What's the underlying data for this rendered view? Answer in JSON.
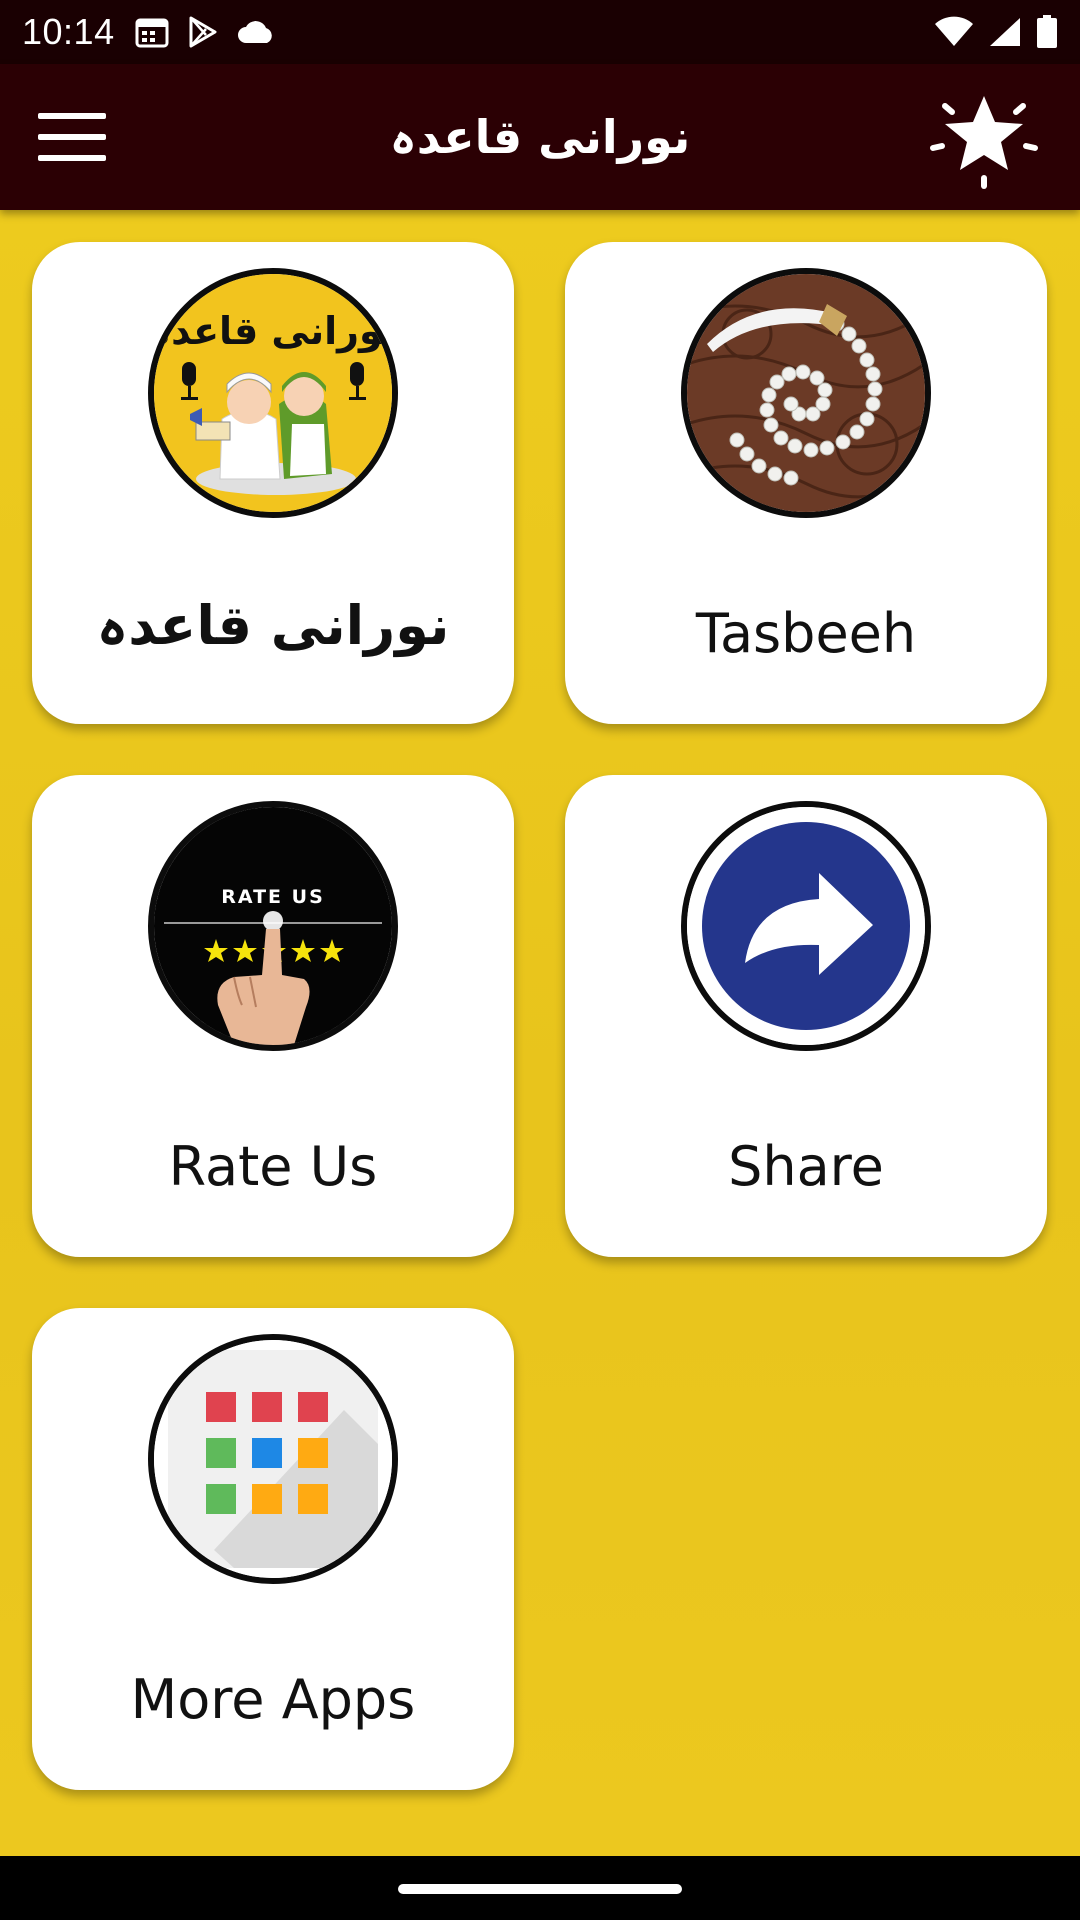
{
  "status_bar": {
    "time": "10:14",
    "left_icons": [
      "calendar-icon",
      "play-store-icon",
      "cloud-icon"
    ],
    "right_icons": [
      "wifi-icon",
      "signal-icon",
      "battery-icon"
    ]
  },
  "app_bar": {
    "title": "نورانی  قاعدہ",
    "menu_icon": "hamburger-menu-icon",
    "action_icon": "star-icon"
  },
  "cards": [
    {
      "id": "noorani-qaida",
      "label": "نورانی قاعدہ",
      "icon": "noorani-qaida-logo",
      "badge_text": "نورانی قاعدہ"
    },
    {
      "id": "tasbeeh",
      "label": "Tasbeeh",
      "icon": "prayer-beads-image"
    },
    {
      "id": "rate-us",
      "label": "Rate Us",
      "icon": "rate-us-image",
      "badge_text": "RATE US"
    },
    {
      "id": "share",
      "label": "Share",
      "icon": "share-arrow-icon"
    },
    {
      "id": "more-apps",
      "label": "More Apps",
      "icon": "app-grid-icon"
    }
  ],
  "colors": {
    "app_bar": "#2b0004",
    "background": "#edcb1e",
    "card": "#ffffff",
    "share_blue": "#24368c"
  }
}
